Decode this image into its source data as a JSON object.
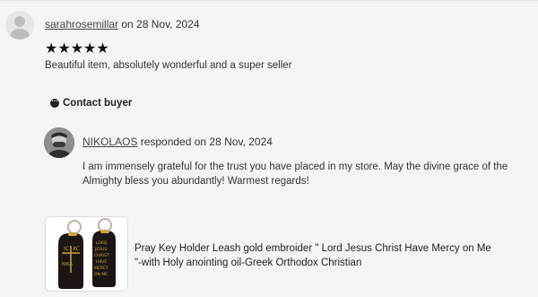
{
  "review": {
    "reviewer_name": "sarahrosemillar",
    "date_text": " on 28 Nov, 2024",
    "stars": "★★★★★",
    "rating": 5,
    "text": "Beautiful item, absolutely wonderful and a super seller"
  },
  "contact": {
    "label": "Contact buyer",
    "icon": "chat-icon"
  },
  "response": {
    "seller_name": "NIKOLAOS",
    "date_text": " responded on 28 Nov, 2024",
    "text": "I am immensely grateful for the trust you have placed in my store. May the divine grace of the Almighty bless you abundantly! Warmest regards!"
  },
  "product": {
    "title": "Pray Key Holder Leash gold embroider \" Lord Jesus Christ Have Mercy on Me \"-with Holy anointing oil-Greek Orthodox Christian",
    "tag_text_left": "IC XC NIKA",
    "tag_text_right": "LORD JESUS CHRIST HAVE MERCY ON ME"
  },
  "colors": {
    "tag": "#1c1514",
    "embroidery": "#c9a43a",
    "ring": "#b8b2a6"
  }
}
